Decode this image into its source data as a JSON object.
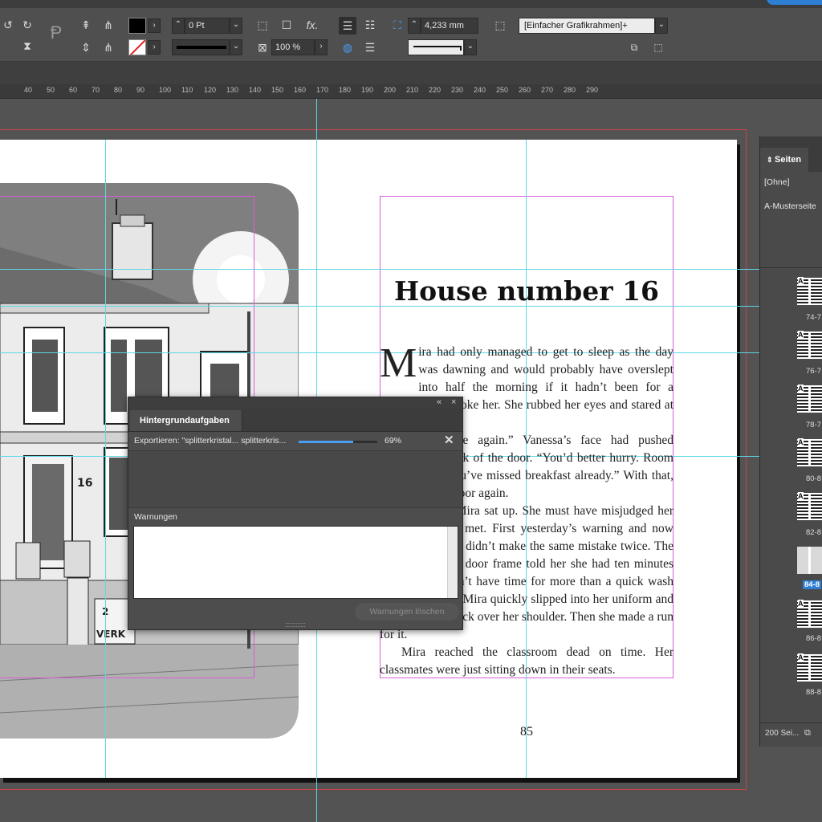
{
  "control_bar": {
    "stroke_weight": "0 Pt",
    "scale": "100 %",
    "dimension": "4,233 mm",
    "frame_style": "[Einfacher Grafikrahmen]+",
    "fx_label": "fx."
  },
  "ruler": {
    "ticks": [
      "40",
      "50",
      "60",
      "70",
      "80",
      "90",
      "100",
      "110",
      "120",
      "130",
      "140",
      "150",
      "160",
      "170",
      "180",
      "190",
      "200",
      "210",
      "220",
      "230",
      "240",
      "250",
      "260",
      "270",
      "280",
      "290"
    ]
  },
  "document": {
    "chapter_title": "House number 16",
    "drop_cap": "M",
    "paragraphs": [
      "ira had only managed to get to sleep as the day was dawning and would probably have overslept into half the morning if it hadn’t been for a knocking that woke her. She rubbed her eyes and stared at the door.",
      "“You’re late again.” Vanessa’s face had pushed through the crack of the door. “You’d better hurry. Room B2. Physics. You’ve missed breakfast already.” With that, she closed the door again.",
      "Groaning, Mira sat up. She must have misjudged her when they first met. First yesterday’s warning and now making sure she didn’t make the same mistake twice. The clock above the door frame told her she had ten minutes left. She wouldn’t have time for more than a quick wash over the basin – Mira quickly slipped into her uniform and threw her rucksack over her shoulder. Then she made a run for it.",
      "Mira reached the classroom dead on time. Her classmates were just sitting down in their seats."
    ],
    "page_number": "85",
    "illustration": {
      "house_number": "16",
      "sign_top": "2",
      "sign_text": "VERK"
    }
  },
  "dialog": {
    "tab": "Hintergrundaufgaben",
    "task_label": "Exportieren: \"splitterkristal... splitterkris...",
    "progress_percent": 69,
    "progress_label": "69%",
    "warnings_label": "Warnungen",
    "clear_button": "Warnungen löschen",
    "collapse_glyph": "«",
    "close_glyph": "×",
    "cancel_glyph": "✕"
  },
  "pages_panel": {
    "tab": "Seiten",
    "masters": [
      "[Ohne]",
      "A-Musterseite"
    ],
    "spreads": [
      {
        "label": "74-7",
        "selected": false
      },
      {
        "label": "76-7",
        "selected": false
      },
      {
        "label": "78-7",
        "selected": false
      },
      {
        "label": "80-8",
        "selected": false
      },
      {
        "label": "82-8",
        "selected": false
      },
      {
        "label": "84-8",
        "selected": true
      },
      {
        "label": "86-8",
        "selected": false
      },
      {
        "label": "88-8",
        "selected": false
      }
    ],
    "footer": "200 Sei..."
  }
}
